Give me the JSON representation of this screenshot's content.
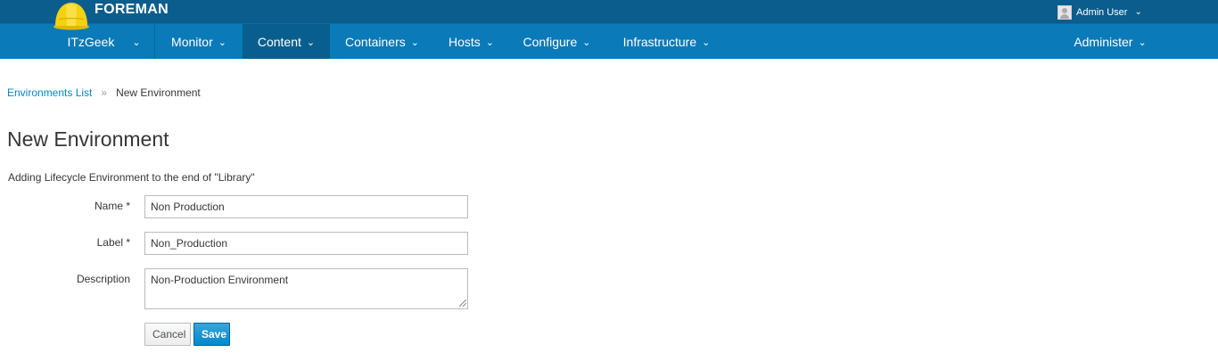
{
  "brand": {
    "name": "FOREMAN"
  },
  "user_menu": {
    "label": "Admin User"
  },
  "nav": {
    "org": "ITzGeek",
    "items": [
      "Monitor",
      "Content",
      "Containers",
      "Hosts",
      "Configure",
      "Infrastructure"
    ],
    "active": "Content",
    "right": "Administer"
  },
  "breadcrumb": {
    "parent": "Environments List",
    "separator": "»",
    "current": "New Environment"
  },
  "page": {
    "title": "New Environment",
    "intro": "Adding Lifecycle Environment to the end of \"Library\""
  },
  "form": {
    "name_label": "Name *",
    "name_value": "Non Production",
    "label_label": "Label *",
    "label_value": "Non_Production",
    "description_label": "Description",
    "description_value": "Non-Production Environment",
    "cancel_label": "Cancel",
    "save_label": "Save"
  },
  "colors": {
    "topbar": "#0a5d8c",
    "navbar": "#0a7ab8",
    "nav_active": "#085f8f",
    "link": "#0088ce",
    "primary_button": "#0088ce"
  }
}
